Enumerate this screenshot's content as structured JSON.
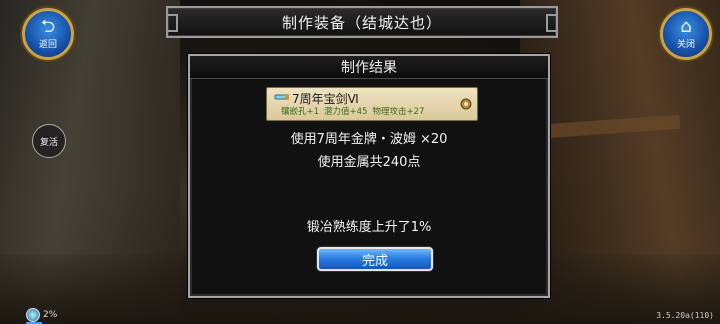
{
  "header": {
    "title": "制作装备（结城达也）",
    "back_label": "返回",
    "close_label": "关闭"
  },
  "side": {
    "revive_label": "复活"
  },
  "dialog": {
    "title": "制作结果",
    "item": {
      "name": "7周年宝剑Ⅵ",
      "stat_1": "镶嵌孔+1",
      "stat_2": "潜力值+45",
      "stat_3": "物理攻击+27"
    },
    "line_1": "使用7周年金牌・波姆 ×20",
    "line_2": "使用金属共240点",
    "line_3": "锻冶熟练度上升了1%",
    "done_label": "完成"
  },
  "status": {
    "exp_percent": "2%",
    "version": "3.5.20a(110)"
  }
}
